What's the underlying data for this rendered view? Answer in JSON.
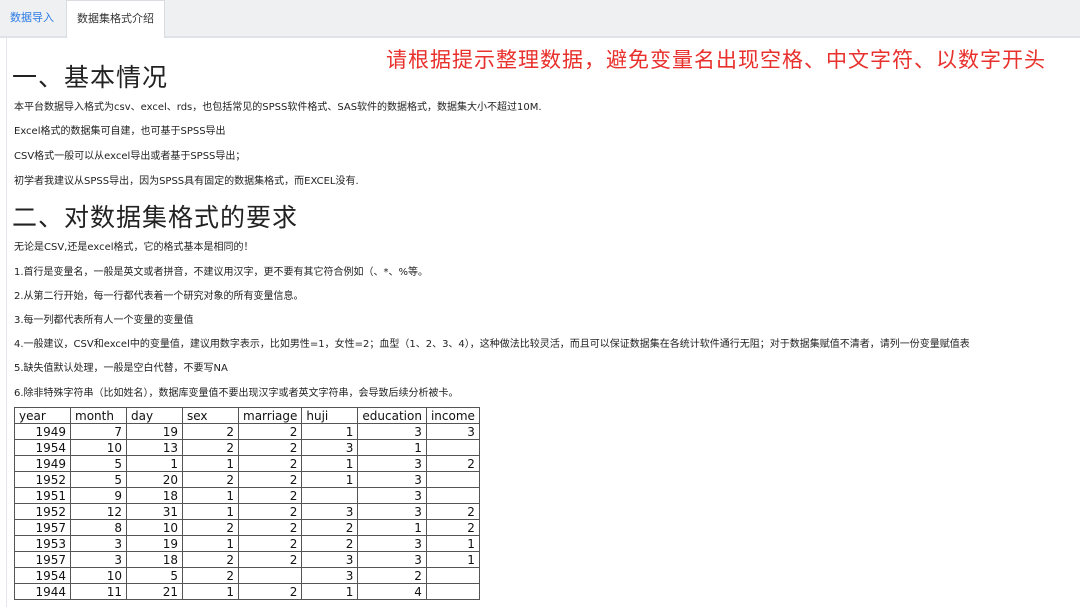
{
  "tabs": [
    {
      "label": "数据导入"
    },
    {
      "label": "数据集格式介绍"
    }
  ],
  "notice": "请根据提示整理数据，避免变量名出现空格、中文字符、以数字开头",
  "section1": {
    "heading": "一、基本情况",
    "paragraphs": [
      "本平台数据导入格式为csv、excel、rds，也包括常见的SPSS软件格式、SAS软件的数据格式，数据集大小不超过10M.",
      "Excel格式的数据集可自建，也可基于SPSS导出",
      "CSV格式一般可以从excel导出或者基于SPSS导出；",
      "初学者我建议从SPSS导出，因为SPSS具有固定的数据集格式，而EXCEL没有."
    ]
  },
  "section2": {
    "heading": "二、对数据集格式的要求",
    "paragraphs": [
      "无论是CSV,还是excel格式，它的格式基本是相同的！",
      "1.首行是变量名，一般是英文或者拼音，不建议用汉字，更不要有其它符合例如（、*、%等。",
      "2.从第二行开始，每一行都代表着一个研究对象的所有变量信息。",
      "3.每一列都代表所有人一个变量的变量值",
      "4.一般建议，CSV和excel中的变量值，建议用数字表示，比如男性=1，女性=2；血型（1、2、3、4），这种做法比较灵活，而且可以保证数据集在各统计软件通行无阻；对于数据集赋值不清者，请列一份变量赋值表",
      "5.缺失值默认处理，一般是空白代替，不要写NA",
      "6.除非特殊字符串（比如姓名），数据库变量值不要出现汉字或者英文字符串，会导致后续分析被卡。"
    ]
  },
  "table": {
    "columns": [
      "year",
      "month",
      "day",
      "sex",
      "marriage",
      "huji",
      "education",
      "income"
    ],
    "rows": [
      [
        "1949",
        "7",
        "19",
        "2",
        "2",
        "1",
        "3",
        "3"
      ],
      [
        "1954",
        "10",
        "13",
        "2",
        "2",
        "3",
        "1",
        ""
      ],
      [
        "1949",
        "5",
        "1",
        "1",
        "2",
        "1",
        "3",
        "2"
      ],
      [
        "1952",
        "5",
        "20",
        "2",
        "2",
        "1",
        "3",
        ""
      ],
      [
        "1951",
        "9",
        "18",
        "1",
        "2",
        "",
        "3",
        ""
      ],
      [
        "1952",
        "12",
        "31",
        "1",
        "2",
        "3",
        "3",
        "2"
      ],
      [
        "1957",
        "8",
        "10",
        "2",
        "2",
        "2",
        "1",
        "2"
      ],
      [
        "1953",
        "3",
        "19",
        "1",
        "2",
        "2",
        "3",
        "1"
      ],
      [
        "1957",
        "3",
        "18",
        "2",
        "2",
        "3",
        "3",
        "1"
      ],
      [
        "1954",
        "10",
        "5",
        "2",
        "",
        "3",
        "2",
        ""
      ],
      [
        "1944",
        "11",
        "21",
        "1",
        "2",
        "1",
        "4",
        ""
      ]
    ]
  }
}
